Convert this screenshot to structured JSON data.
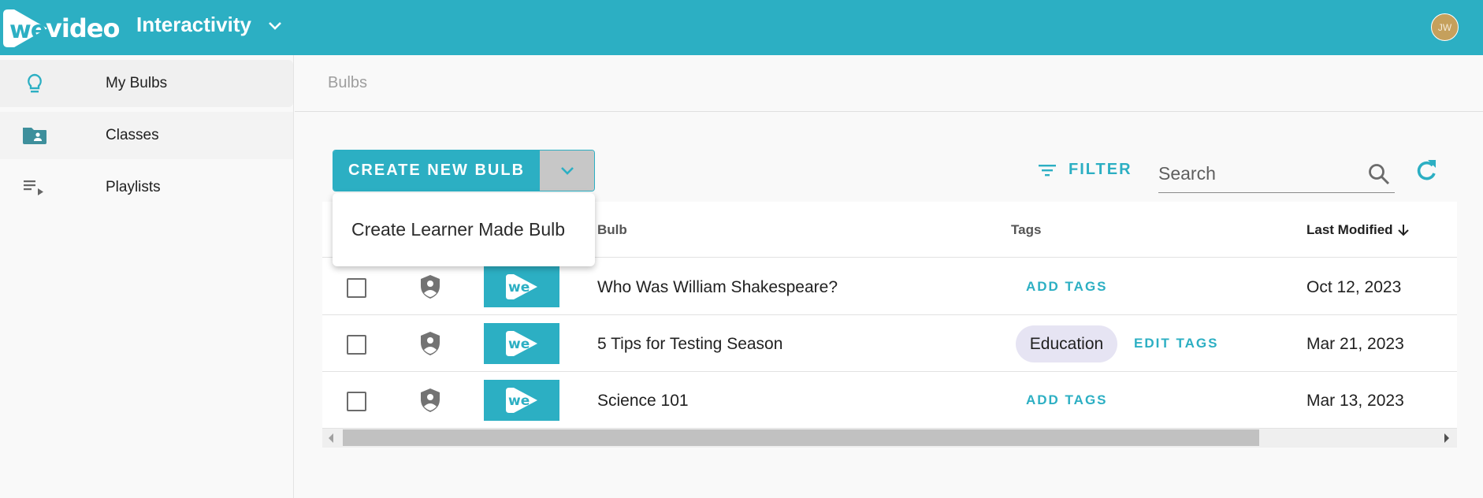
{
  "header": {
    "logo_we": "we",
    "logo_video": "video",
    "app_name": "Interactivity",
    "app_switcher_icon": "chevron-down-icon",
    "avatar_initials": "JW",
    "accent_color": "#2cafc3",
    "avatar_color": "#c5a05c"
  },
  "sidebar": {
    "items": [
      {
        "label": "My Bulbs",
        "icon": "lightbulb-icon",
        "active": true
      },
      {
        "label": "Classes",
        "icon": "folder-shared-icon",
        "active": false
      },
      {
        "label": "Playlists",
        "icon": "playlist-play-icon",
        "active": false
      }
    ]
  },
  "main": {
    "breadcrumb": "Bulbs",
    "create_button": "CREATE NEW BULB",
    "create_dropdown_icon": "chevron-down-icon",
    "create_menu": [
      "Create Learner Made Bulb"
    ],
    "filter_label": "FILTER",
    "search": {
      "placeholder": "Search",
      "value": ""
    },
    "table": {
      "columns": [
        "",
        "",
        "",
        "Bulb",
        "Tags",
        "Last Modified"
      ],
      "sort_column": "Last Modified",
      "sort_direction": "descending",
      "rows": [
        {
          "title": "Who Was William Shakespeare?",
          "tags": [],
          "tag_action": "ADD TAGS",
          "last_modified": "Oct 12, 2023",
          "thumb": "we"
        },
        {
          "title": "5 Tips for Testing Season",
          "tags": [
            "Education"
          ],
          "tag_action": "EDIT TAGS",
          "last_modified": "Mar 21, 2023",
          "thumb": "we"
        },
        {
          "title": "Science 101",
          "tags": [],
          "tag_action": "ADD TAGS",
          "last_modified": "Mar 13, 2023",
          "thumb": "we"
        }
      ]
    },
    "horizontal_scroll_position": 0
  }
}
